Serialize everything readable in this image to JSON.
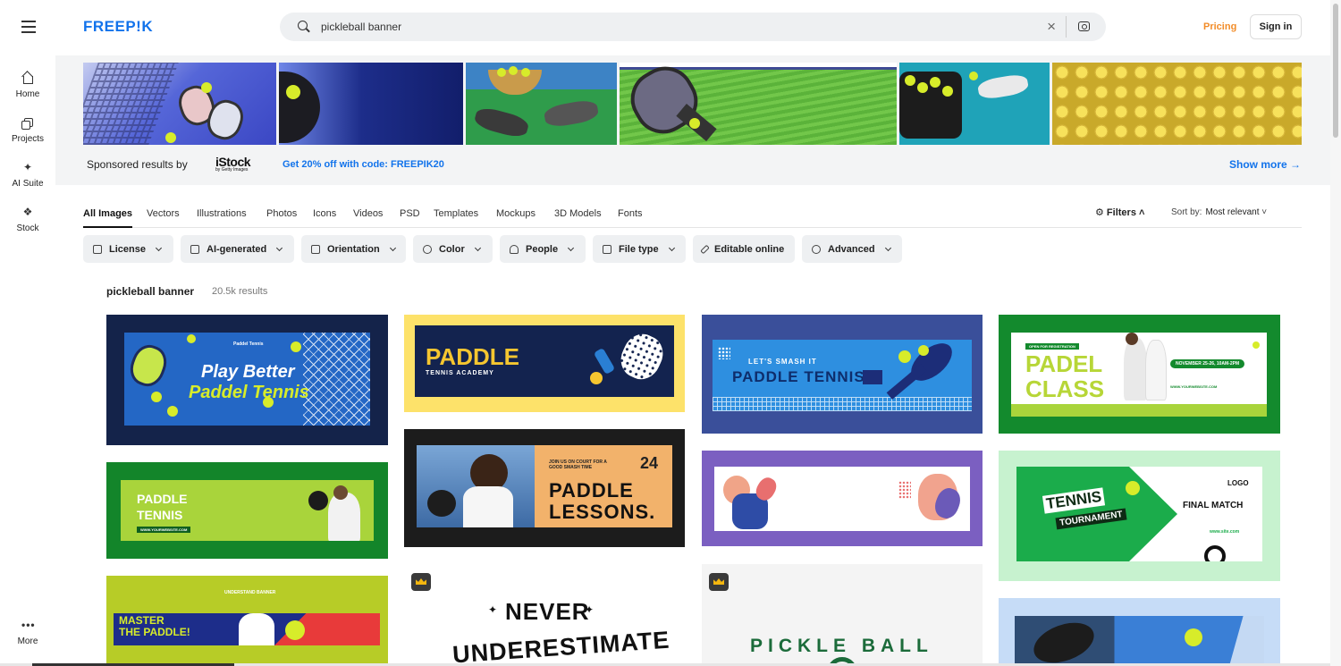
{
  "header": {
    "logo": "FREEP!K",
    "search_value": "pickleball banner",
    "pricing": "Pricing",
    "signin": "Sign in"
  },
  "sidebar": {
    "items": [
      {
        "label": "Home",
        "icon": "home-icon"
      },
      {
        "label": "Projects",
        "icon": "projects-icon"
      },
      {
        "label": "AI Suite",
        "icon": "sparkle-icon"
      },
      {
        "label": "Stock",
        "icon": "stock-icon"
      }
    ],
    "more": "More"
  },
  "sponsored": {
    "label": "Sponsored results by",
    "brand": "iStock",
    "brand_sub": "by Getty Images",
    "promo": "Get 20% off with code: FREEPIK20",
    "show_more": "Show more →"
  },
  "tabs": [
    "All Images",
    "Vectors",
    "Illustrations",
    "Photos",
    "Icons",
    "Videos",
    "PSD",
    "Templates",
    "Mockups",
    "3D Models",
    "Fonts"
  ],
  "filters_label": "Filters",
  "sort": {
    "label": "Sort by:",
    "value": "Most relevant"
  },
  "chips": [
    "License",
    "AI-generated",
    "Orientation",
    "Color",
    "People",
    "File type",
    "Editable online",
    "Advanced"
  ],
  "results": {
    "query": "pickleball banner",
    "count": "20.5k results"
  },
  "cards": {
    "c1_title1": "Play Better",
    "c1_title2": "Paddel Tennis",
    "c1_logo": "Paddel Tennis",
    "c2_title": "PADDLE",
    "c2_sub": "TENNIS ACADEMY",
    "c3_kicker": "LET'S SMASH IT",
    "c3_title": "PADDLE TENNIS",
    "c4_tag": "OPEN FOR REGISTRATION",
    "c4_title1": "PADEL",
    "c4_title2": "CLASS",
    "c4_date": "NOVEMBER 25-26, 10AM-2PM",
    "c4_site": "WWW.YOURWEBSITE.COM",
    "c5_title1": "PADDLE",
    "c5_title2": "TENNIS",
    "c5_site": "WWW.YOURWEBSITE.COM",
    "c6_kicker": "JOIN US ON COURT FOR A GOOD SMASH TIME",
    "c6_num": "24",
    "c6_title1": "PADDLE",
    "c6_title2": "LESSONS.",
    "c8_logo": "LOGO",
    "c8_title1": "TENNIS",
    "c8_title2": "TOURNAMENT",
    "c8_final": "FINAL MATCH",
    "c8_site": "www.site.com",
    "c9_kicker": "UNDERSTAND BANNER",
    "c9_title1": "MASTER",
    "c9_title2": "THE PADDLE!",
    "c10_line1": "NEVER",
    "c10_line2": "UNDERESTIMATE",
    "c11_title": "PICKLE BALL"
  },
  "colors": {
    "brand": "#1273eb",
    "pricing": "#f28c28",
    "chip_bg": "#eef0f2"
  }
}
